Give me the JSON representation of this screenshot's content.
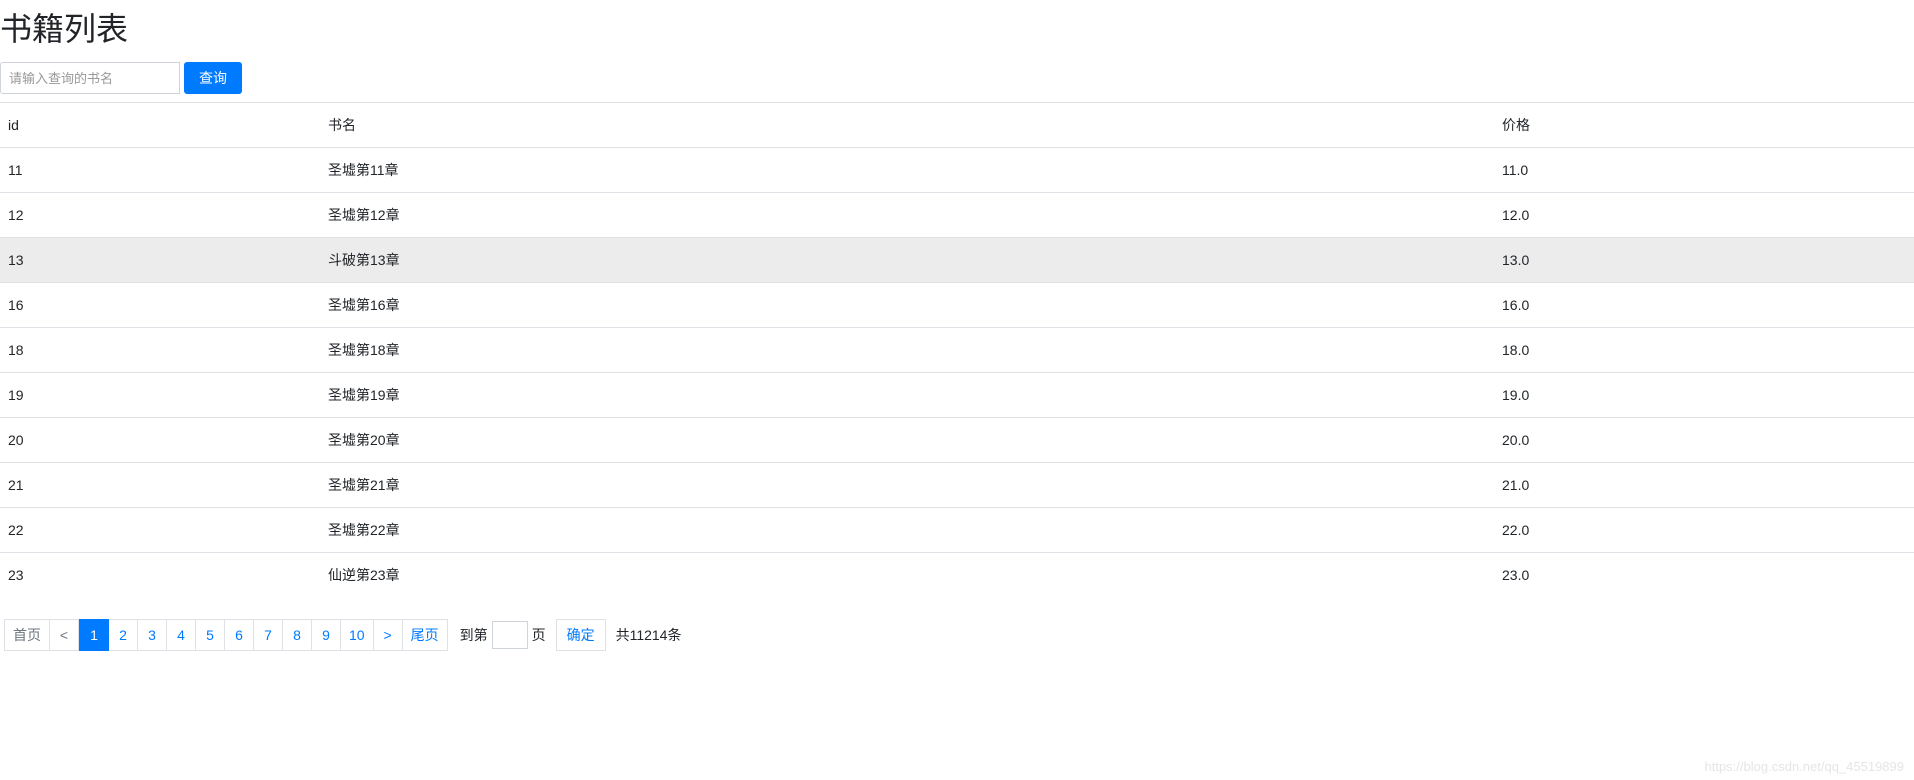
{
  "page": {
    "title": "书籍列表"
  },
  "search": {
    "placeholder": "请输入查询的书名",
    "button": "查询"
  },
  "table": {
    "headers": {
      "id": "id",
      "name": "书名",
      "price": "价格"
    },
    "rows": [
      {
        "id": "11",
        "name": "圣墟第11章",
        "price": "11.0"
      },
      {
        "id": "12",
        "name": "圣墟第12章",
        "price": "12.0"
      },
      {
        "id": "13",
        "name": "斗破第13章",
        "price": "13.0"
      },
      {
        "id": "16",
        "name": "圣墟第16章",
        "price": "16.0"
      },
      {
        "id": "18",
        "name": "圣墟第18章",
        "price": "18.0"
      },
      {
        "id": "19",
        "name": "圣墟第19章",
        "price": "19.0"
      },
      {
        "id": "20",
        "name": "圣墟第20章",
        "price": "20.0"
      },
      {
        "id": "21",
        "name": "圣墟第21章",
        "price": "21.0"
      },
      {
        "id": "22",
        "name": "圣墟第22章",
        "price": "22.0"
      },
      {
        "id": "23",
        "name": "仙逆第23章",
        "price": "23.0"
      }
    ],
    "hovered_index": 2
  },
  "pagination": {
    "first": "首页",
    "prev": "<",
    "pages": [
      "1",
      "2",
      "3",
      "4",
      "5",
      "6",
      "7",
      "8",
      "9",
      "10"
    ],
    "active_page": "1",
    "next": ">",
    "last": "尾页",
    "goto_prefix": "到第",
    "goto_suffix": "页",
    "confirm": "确定",
    "total": "共11214条"
  },
  "watermark": "https://blog.csdn.net/qq_45519899"
}
